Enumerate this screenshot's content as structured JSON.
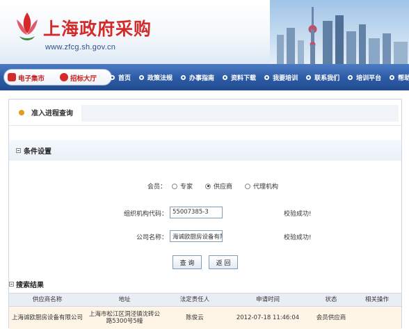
{
  "banner": {
    "site_title": "上海政府采购",
    "site_url": "www.zfcg.sh.gov.cn"
  },
  "nav": {
    "pill_left": "电子集市",
    "pill_right": "招标大厅",
    "items": [
      {
        "label": "首页"
      },
      {
        "label": "政策法规"
      },
      {
        "label": "办事指南"
      },
      {
        "label": "资料下载"
      },
      {
        "label": "我要培训"
      },
      {
        "label": "联系我们"
      },
      {
        "label": "培训平台"
      },
      {
        "label": "帮助"
      }
    ]
  },
  "page": {
    "process_title": "准入进程查询"
  },
  "conditions": {
    "title": "条件设置",
    "member_label": "会员：",
    "member_options": [
      {
        "label": "专家",
        "selected": false
      },
      {
        "label": "供应商",
        "selected": true
      },
      {
        "label": "代理机构",
        "selected": false
      }
    ],
    "org_code_label": "组织机构代码：",
    "org_code_value": "55007385-3",
    "org_code_status": "校验成功!",
    "company_label": "公司名称：",
    "company_value": "海诚欧厨房设备有限公司",
    "company_status": "校验成功!",
    "query_button": "查 询",
    "back_button": "返 回"
  },
  "results": {
    "title": "搜索结果",
    "columns": [
      "供应商名称",
      "地址",
      "法定责任人",
      "申请时间",
      "状态",
      "相关操作"
    ],
    "rows": [
      {
        "supplier": "上海诚欧厨房设备有限公司",
        "address": "上海市松江区洞泾镇沈砖公路5300号5幢",
        "legal_person": "陈俊云",
        "apply_time": "2012-07-18 11:46:04",
        "status": "会员供应商",
        "action": ""
      }
    ]
  },
  "colors": {
    "brand_red": "#d42a2a",
    "nav_blue": "#2f5ea8",
    "row_highlight": "#fff5e6"
  }
}
